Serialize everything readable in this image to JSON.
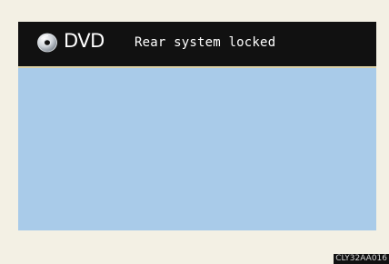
{
  "header": {
    "source_label": "DVD",
    "source_icon": "disc-icon",
    "status_message": "Rear system locked"
  },
  "footer": {
    "image_code": "CLY32AA016"
  },
  "colors": {
    "page_background": "#f3f0e4",
    "header_background": "#111111",
    "header_border": "#d9cfa6",
    "screen_background": "#a9cbe9",
    "text": "#ffffff"
  }
}
